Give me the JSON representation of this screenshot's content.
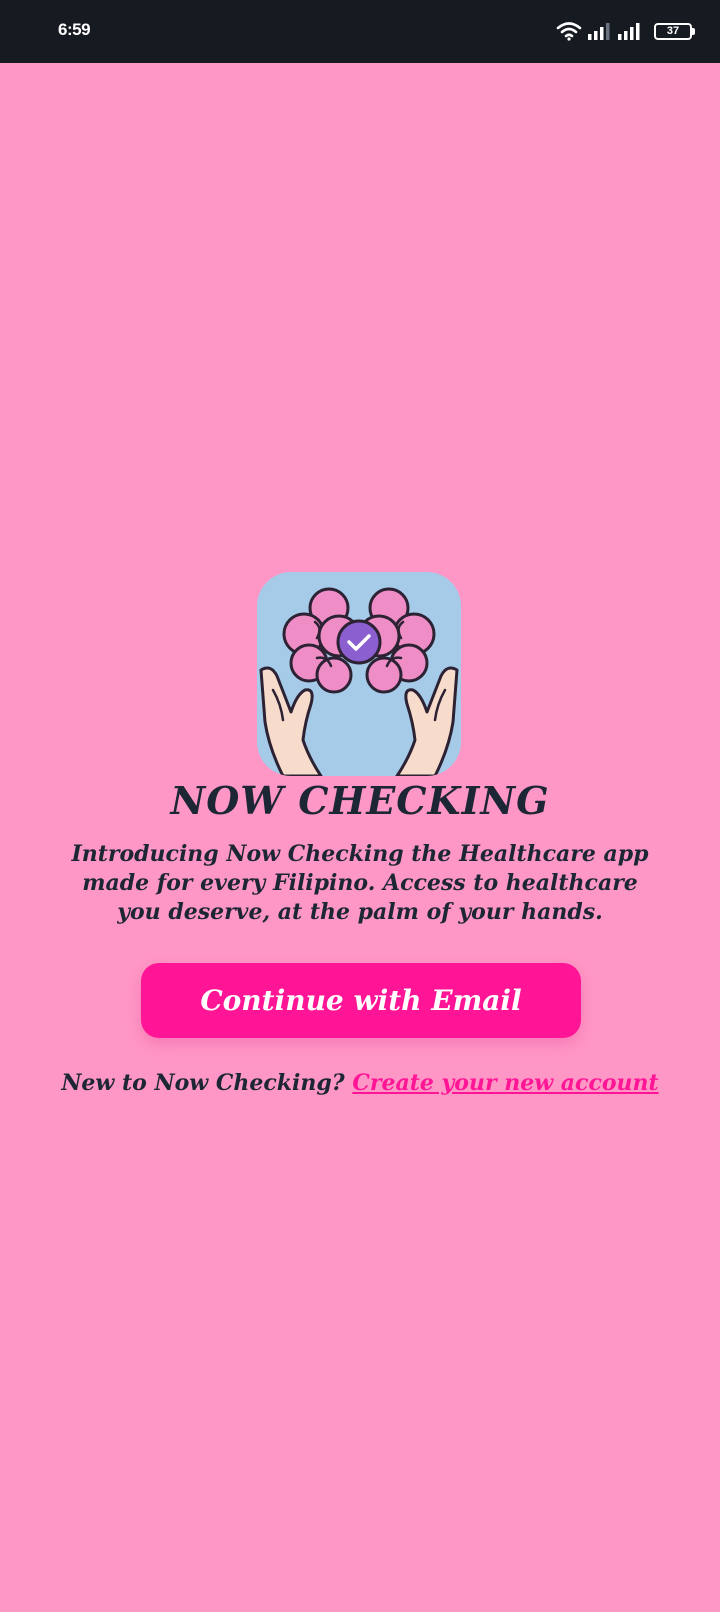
{
  "status_bar": {
    "time": "6:59",
    "battery": "37",
    "icons": [
      "wifi-icon",
      "signal-icon",
      "signal-icon",
      "battery-icon"
    ]
  },
  "app": {
    "title": "NOW CHECKING",
    "description": "Introducing Now Checking the Healthcare app made for every Filipino. Access to healthcare you deserve, at the palm of your hands.",
    "logo_icon": "brain-hands-check-icon"
  },
  "actions": {
    "continue_label": "Continue with Email",
    "signup_prompt": "New to Now Checking?",
    "signup_link": "Create your new account"
  },
  "colors": {
    "background": "#ff97c6",
    "status_bar": "#161b22",
    "accent": "#ff1595",
    "text": "#1d2634",
    "logo_bg": "#a5cbe8"
  }
}
